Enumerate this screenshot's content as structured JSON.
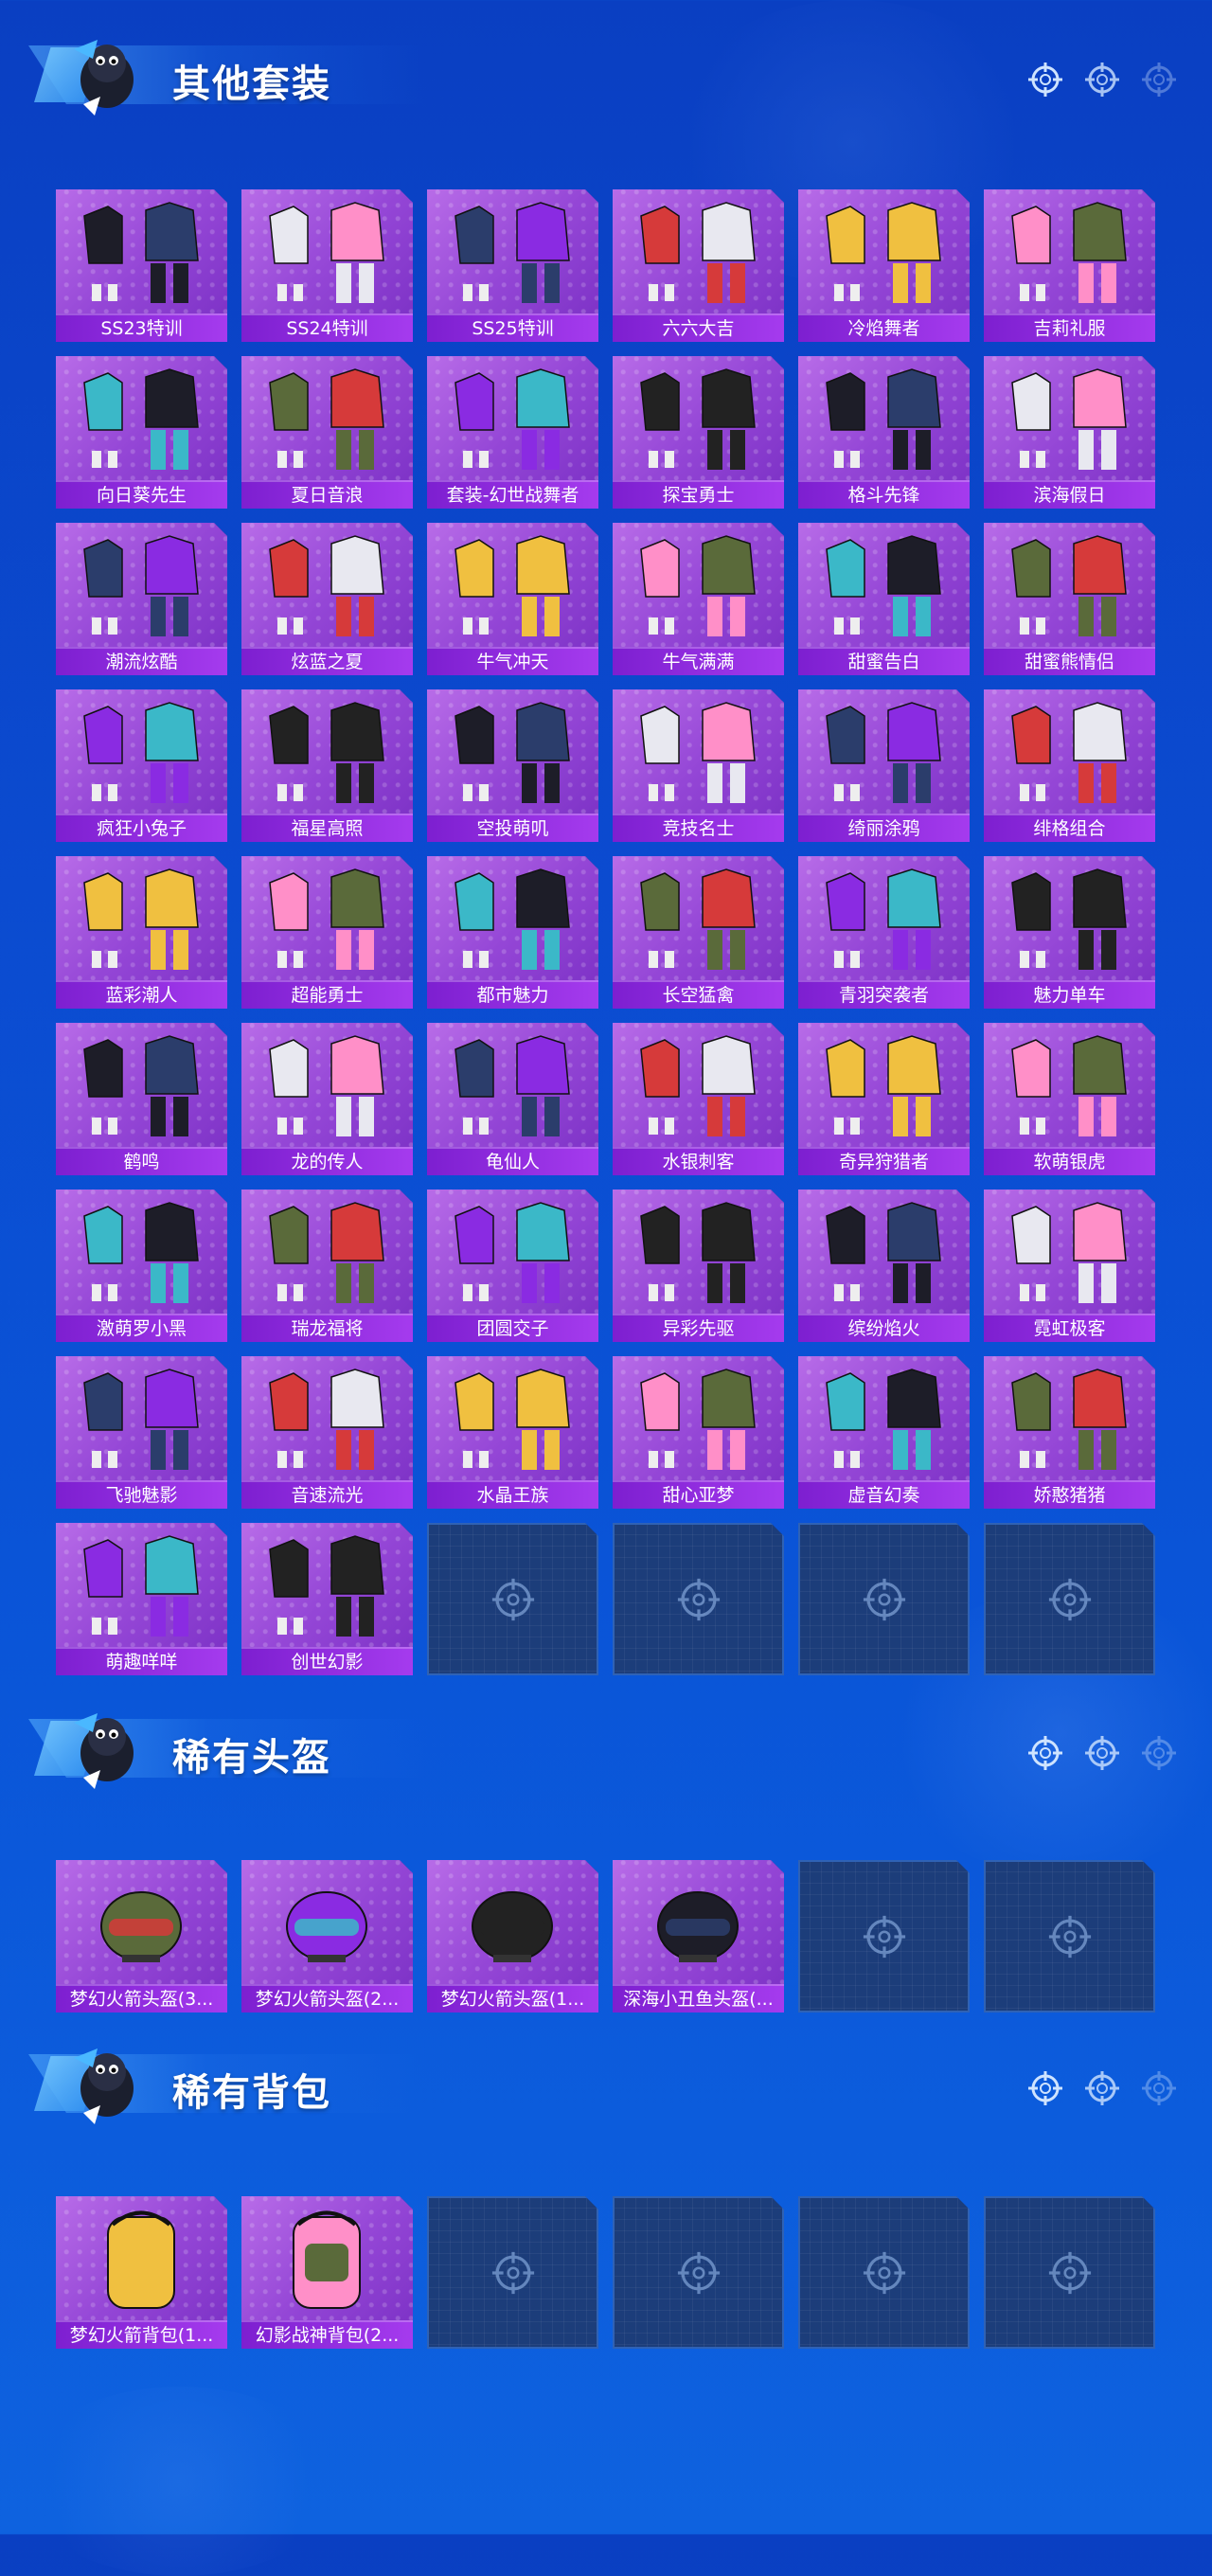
{
  "colors": {
    "background": "#0b4bd0",
    "card_purple": "#a055e0",
    "label_bar": "#8b28dc",
    "empty_card": "#1c3d7a"
  },
  "sections": [
    {
      "title": "其他套装",
      "items": [
        "SS23特训",
        "SS24特训",
        "SS25特训",
        "六六大吉",
        "冷焰舞者",
        "吉莉礼服",
        "向日葵先生",
        "夏日音浪",
        "套装-幻世战舞者",
        "探宝勇士",
        "格斗先锋",
        "滨海假日",
        "潮流炫酷",
        "炫蓝之夏",
        "牛气冲天",
        "牛气满满",
        "甜蜜告白",
        "甜蜜熊情侣",
        "疯狂小兔子",
        "福星高照",
        "空投萌叽",
        "竞技名士",
        "绮丽涂鸦",
        "绯格组合",
        "蓝彩潮人",
        "超能勇士",
        "都市魅力",
        "长空猛禽",
        "青羽突袭者",
        "魅力单车",
        "鹤鸣",
        "龙的传人",
        "龟仙人",
        "水银刺客",
        "奇异狩猎者",
        "软萌银虎",
        "激萌罗小黑",
        "瑞龙福将",
        "团圆交子",
        "异彩先驱",
        "缤纷焰火",
        "霓虹极客",
        "飞驰魅影",
        "音速流光",
        "水晶王族",
        "甜心亚梦",
        "虚音幻奏",
        "娇憨猪猪",
        "萌趣咩咩",
        "创世幻影"
      ],
      "empty_slots": 4
    },
    {
      "title": "稀有头盔",
      "items": [
        "梦幻火箭头盔(3...",
        "梦幻火箭头盔(2...",
        "梦幻火箭头盔(1...",
        "深海小丑鱼头盔(..."
      ],
      "empty_slots": 2
    },
    {
      "title": "稀有背包",
      "items": [
        "梦幻火箭背包(1...",
        "幻影战神背包(2..."
      ],
      "empty_slots": 4
    }
  ]
}
